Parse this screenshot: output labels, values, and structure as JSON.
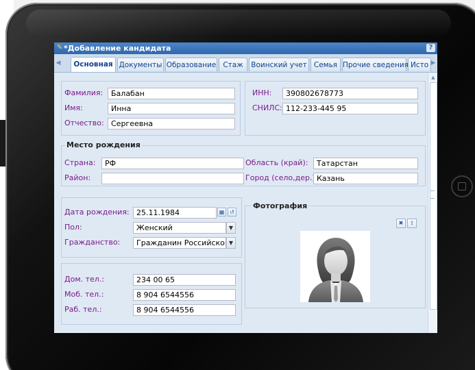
{
  "window": {
    "title": "*Добавление кандидата",
    "help": "?"
  },
  "tabs": [
    {
      "label": "Основная",
      "active": true
    },
    {
      "label": "Документы"
    },
    {
      "label": "Образование"
    },
    {
      "label": "Стаж"
    },
    {
      "label": "Воинский учет"
    },
    {
      "label": "Семья"
    },
    {
      "label": "Прочие сведения"
    },
    {
      "label": "Исто"
    }
  ],
  "name": {
    "lastname_label": "Фамилия:",
    "lastname": "Балабан",
    "firstname_label": "Имя:",
    "firstname": "Инна",
    "patronymic_label": "Отчество:",
    "patronymic": "Сергеевна"
  },
  "ids": {
    "inn_label": "ИНН:",
    "inn": "390802678773",
    "snils_label": "СНИЛС:",
    "snils": "112-233-445 95"
  },
  "birthplace": {
    "title": "Место рождения",
    "country_label": "Страна:",
    "country": "РФ",
    "region_label": "Область (край):",
    "region": "Татарстан",
    "district_label": "Район:",
    "district": "",
    "city_label": "Город (село,дер.):",
    "city": "Казань"
  },
  "personal": {
    "birthdate_label": "Дата рождения:",
    "birthdate": "25.11.1984",
    "gender_label": "Пол:",
    "gender": "Женский",
    "citizenship_label": "Гражданство:",
    "citizenship": "Гражданин Российской Ф"
  },
  "phones": {
    "home_label": "Дом. тел.:",
    "home": "234 00 65",
    "mobile_label": "Моб. тел.:",
    "mobile": "8 904 6544556",
    "work_label": "Раб. тел.:",
    "work": "8 904 6544556"
  },
  "photo": {
    "title": "Фотография"
  }
}
